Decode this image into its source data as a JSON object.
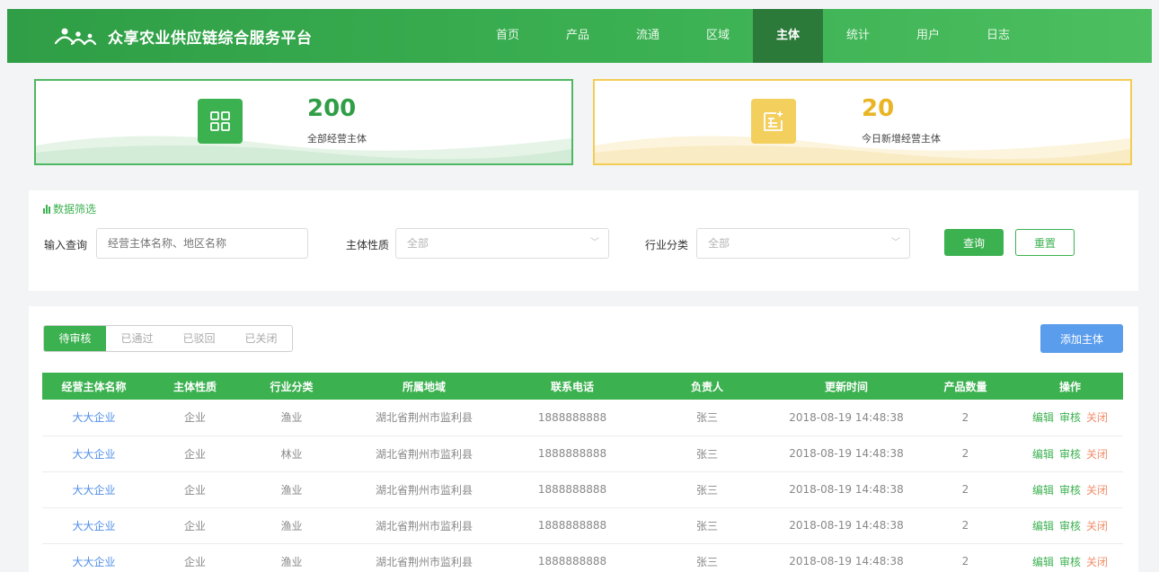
{
  "brand": {
    "title": "众享农业供应链综合服务平台"
  },
  "nav": [
    {
      "label": "首页",
      "active": false
    },
    {
      "label": "产品",
      "active": false
    },
    {
      "label": "流通",
      "active": false
    },
    {
      "label": "区域",
      "active": false
    },
    {
      "label": "主体",
      "active": true
    },
    {
      "label": "统计",
      "active": false
    },
    {
      "label": "用户",
      "active": false
    },
    {
      "label": "日志",
      "active": false
    }
  ],
  "stats": [
    {
      "value": "200",
      "label": "全部经营主体",
      "color": "#3cb150"
    },
    {
      "value": "20",
      "label": "今日新增经营主体",
      "color": "#f3cf5e"
    }
  ],
  "filter": {
    "title": "数据筛选",
    "query_label": "输入查询",
    "query_placeholder": "经营主体名称、地区名称",
    "nature_label": "主体性质",
    "nature_value": "全部",
    "industry_label": "行业分类",
    "industry_value": "全部",
    "query_button": "查询",
    "reset_button": "重置"
  },
  "list": {
    "tabs": [
      {
        "label": "待审核",
        "active": true
      },
      {
        "label": "已通过",
        "active": false
      },
      {
        "label": "已驳回",
        "active": false
      },
      {
        "label": "已关闭",
        "active": false
      }
    ],
    "add_button": "添加主体",
    "columns": [
      "经营主体名称",
      "主体性质",
      "行业分类",
      "所属地域",
      "联系电话",
      "负责人",
      "更新时间",
      "产品数量",
      "操作"
    ],
    "actions": {
      "edit": "编辑",
      "audit": "审核",
      "close": "关闭"
    },
    "rows": [
      {
        "name": "大大企业",
        "nature": "企业",
        "industry": "渔业",
        "region": "湖北省荆州市监利县",
        "phone": "1888888888",
        "owner": "张三",
        "updated": "2018-08-19 14:48:38",
        "count": "2"
      },
      {
        "name": "大大企业",
        "nature": "企业",
        "industry": "林业",
        "region": "湖北省荆州市监利县",
        "phone": "1888888888",
        "owner": "张三",
        "updated": "2018-08-19 14:48:38",
        "count": "2"
      },
      {
        "name": "大大企业",
        "nature": "企业",
        "industry": "渔业",
        "region": "湖北省荆州市监利县",
        "phone": "1888888888",
        "owner": "张三",
        "updated": "2018-08-19 14:48:38",
        "count": "2"
      },
      {
        "name": "大大企业",
        "nature": "企业",
        "industry": "渔业",
        "region": "湖北省荆州市监利县",
        "phone": "1888888888",
        "owner": "张三",
        "updated": "2018-08-19 14:48:38",
        "count": "2"
      },
      {
        "name": "大大企业",
        "nature": "企业",
        "industry": "渔业",
        "region": "湖北省荆州市监利县",
        "phone": "1888888888",
        "owner": "张三",
        "updated": "2018-08-19 14:48:38",
        "count": "2"
      }
    ]
  }
}
